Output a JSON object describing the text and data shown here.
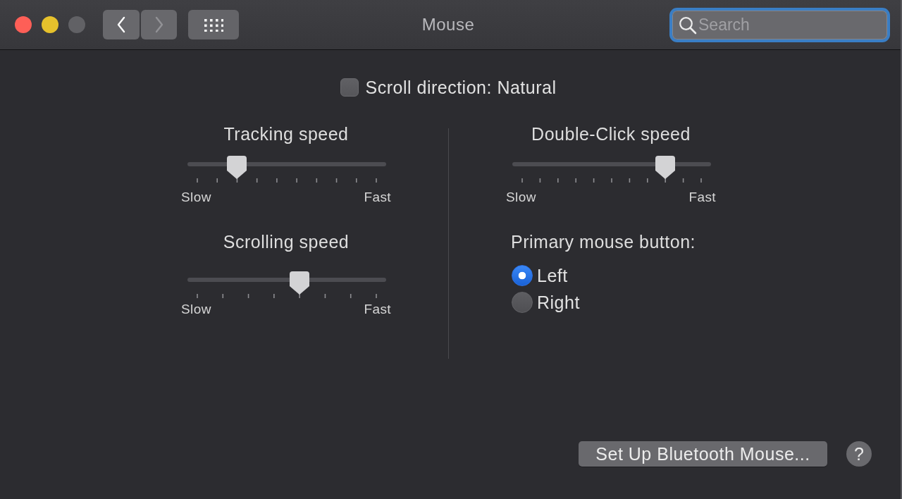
{
  "window": {
    "controls": [
      {
        "kind": "close",
        "disabled": false
      },
      {
        "kind": "minimize",
        "disabled": false
      },
      {
        "kind": "zoom",
        "disabled": true
      }
    ],
    "navigation": [
      {
        "kind": "back",
        "disabled": false
      },
      {
        "kind": "forward",
        "disabled": true
      }
    ],
    "title": "Mouse",
    "search": {
      "placeholder": "Search",
      "focused": true
    }
  },
  "scroll_direction": {
    "label": "Scroll direction: Natural",
    "checked": false
  },
  "left_column": {
    "sliders": [
      {
        "title": "Tracking speed",
        "level": 0.22,
        "min_label": "Slow",
        "max_label": "Fast"
      },
      {
        "title": "Scrolling speed",
        "level": 0.57,
        "min_label": "Slow",
        "max_label": "Fast"
      }
    ]
  },
  "right_column": {
    "slider": {
      "title": "Double-Click speed",
      "level": 0.8,
      "min_label": "Slow",
      "max_label": "Fast"
    },
    "primary_mouse_button": {
      "label": "Primary mouse button:",
      "options": [
        {
          "label": "Left",
          "selected": true
        },
        {
          "label": "Right",
          "selected": false
        }
      ]
    }
  },
  "footer": {
    "setup_button": "Set Up Bluetooth Mouse...",
    "help_button": "?"
  }
}
